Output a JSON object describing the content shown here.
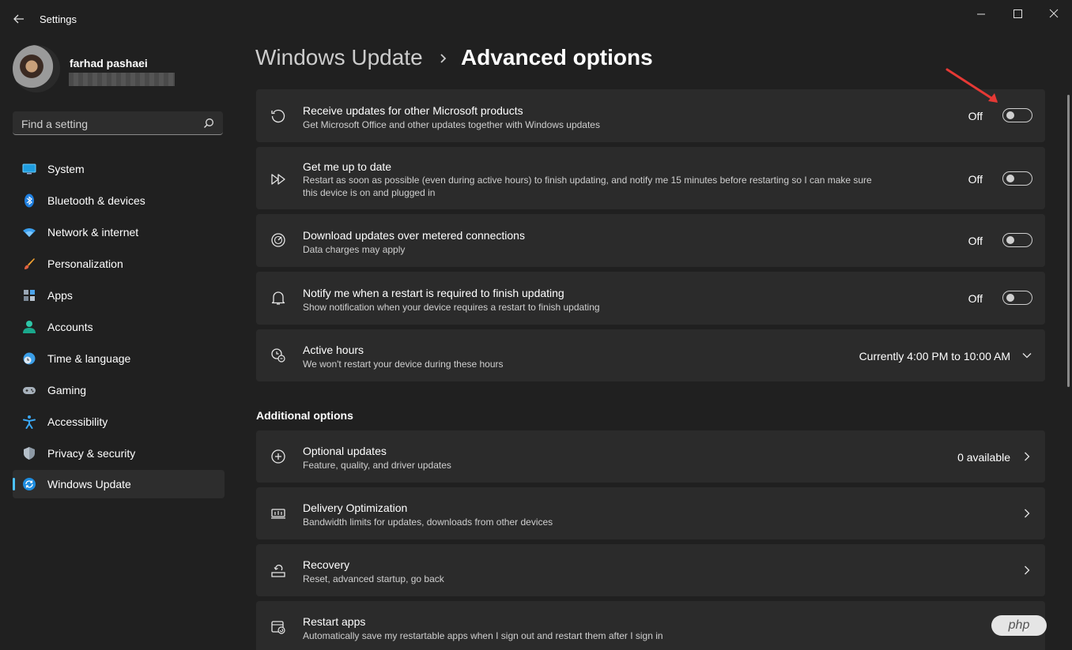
{
  "window": {
    "title": "Settings"
  },
  "profile": {
    "name": "farhad pashaei"
  },
  "search": {
    "placeholder": "Find a setting"
  },
  "sidebar": {
    "items": [
      {
        "label": "System",
        "icon": "monitor-icon"
      },
      {
        "label": "Bluetooth & devices",
        "icon": "bluetooth-icon"
      },
      {
        "label": "Network & internet",
        "icon": "wifi-icon"
      },
      {
        "label": "Personalization",
        "icon": "brush-icon"
      },
      {
        "label": "Apps",
        "icon": "apps-icon"
      },
      {
        "label": "Accounts",
        "icon": "person-icon"
      },
      {
        "label": "Time & language",
        "icon": "globe-clock-icon"
      },
      {
        "label": "Gaming",
        "icon": "gamepad-icon"
      },
      {
        "label": "Accessibility",
        "icon": "accessibility-icon"
      },
      {
        "label": "Privacy & security",
        "icon": "shield-icon"
      },
      {
        "label": "Windows Update",
        "icon": "sync-icon",
        "active": true
      }
    ]
  },
  "breadcrumb": {
    "parent": "Windows Update",
    "current": "Advanced options"
  },
  "settings": [
    {
      "title": "Receive updates for other Microsoft products",
      "desc": "Get Microsoft Office and other updates together with Windows updates",
      "state": "Off",
      "on": false,
      "icon": "history-icon"
    },
    {
      "title": "Get me up to date",
      "desc": "Restart as soon as possible (even during active hours) to finish updating, and notify me 15 minutes before restarting so I can make sure this device is on and plugged in",
      "state": "Off",
      "on": false,
      "icon": "fast-forward-icon"
    },
    {
      "title": "Download updates over metered connections",
      "desc": "Data charges may apply",
      "state": "Off",
      "on": false,
      "icon": "speedometer-icon"
    },
    {
      "title": "Notify me when a restart is required to finish updating",
      "desc": "Show notification when your device requires a restart to finish updating",
      "state": "Off",
      "on": false,
      "icon": "bell-icon"
    },
    {
      "title": "Active hours",
      "desc": "We won't restart your device during these hours",
      "value": "Currently 4:00 PM to 10:00 AM",
      "icon": "clock-icon"
    }
  ],
  "additional": {
    "heading": "Additional options",
    "items": [
      {
        "title": "Optional updates",
        "desc": "Feature, quality, and driver updates",
        "value": "0 available",
        "icon": "plus-circle-icon"
      },
      {
        "title": "Delivery Optimization",
        "desc": "Bandwidth limits for updates, downloads from other devices",
        "icon": "delivery-icon"
      },
      {
        "title": "Recovery",
        "desc": "Reset, advanced startup, go back",
        "icon": "recovery-icon"
      },
      {
        "title": "Restart apps",
        "desc": "Automatically save my restartable apps when I sign out and restart them after I sign in",
        "icon": "restart-apps-icon"
      }
    ]
  },
  "watermark": "php",
  "colors": {
    "accent": "#4cc2ff",
    "annotation_arrow": "#e53935",
    "background": "#202020",
    "card": "#2b2b2b"
  }
}
